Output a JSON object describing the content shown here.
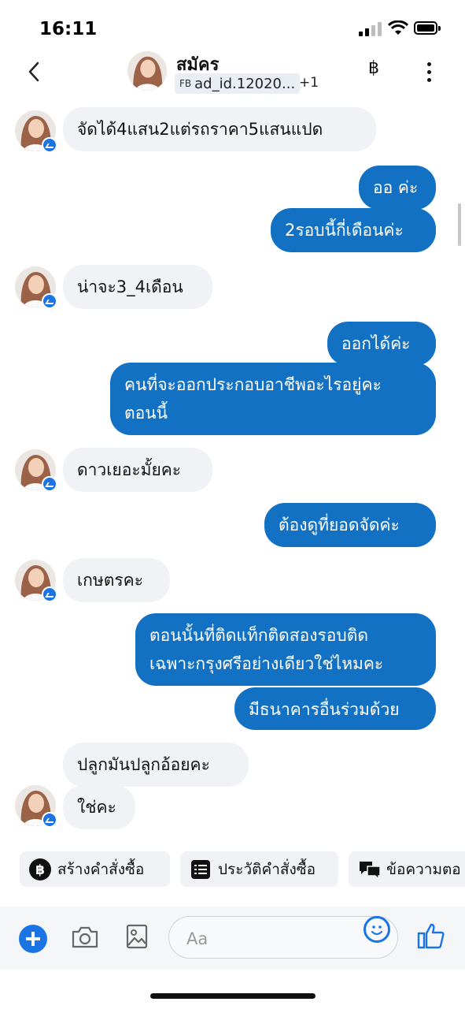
{
  "status_bar": {
    "time": "16:11"
  },
  "header": {
    "name": "สมัคร",
    "tag_prefix": "FB",
    "tag": "ad_id.12020...",
    "extra": "+1",
    "currency_symbol": "฿"
  },
  "messages": [
    {
      "dir": "in",
      "text": "จัดได้4แสน2แต่รถราคา5แสนแปด"
    },
    {
      "dir": "out",
      "text": "ออ ค่ะ"
    },
    {
      "dir": "out",
      "text": "2รอบนี้กี่เดือนค่ะ"
    },
    {
      "dir": "in",
      "text": "น่าจะ3_4เดือน"
    },
    {
      "dir": "out",
      "text": "ออกได้ค่ะ"
    },
    {
      "dir": "out",
      "text_line1": "คนที่จะออกประกอบอาชีพอะไรอยู่คะ",
      "text_line2": "ตอนนี้"
    },
    {
      "dir": "in",
      "text": "ดาวเยอะมั้ยคะ"
    },
    {
      "dir": "out",
      "text": "ต้องดูที่ยอดจัดค่ะ"
    },
    {
      "dir": "in",
      "text": "เกษตรคะ"
    },
    {
      "dir": "out",
      "text_line1": "ตอนนั้นที่ติดแท็กติดสองรอบติด",
      "text_line2": "เฉพาะกรุงศรีอย่างเดียวใช่ไหมคะ"
    },
    {
      "dir": "out",
      "text": "มีธนาคารอื่นร่วมด้วย"
    },
    {
      "dir": "in",
      "text": "ปลูกมันปลูกอ้อยคะ"
    },
    {
      "dir": "in",
      "text": "ใช่คะ"
    }
  ],
  "quick_actions": [
    {
      "label": "สร้างคำสั่งซื้อ",
      "icon": "baht-circle-icon"
    },
    {
      "label": "ประวัติคำสั่งซื้อ",
      "icon": "order-list-icon"
    },
    {
      "label": "ข้อความตอ",
      "icon": "chat-bubbles-icon"
    }
  ],
  "composer": {
    "placeholder": "Aa"
  },
  "colors": {
    "accent": "#1b74e4",
    "outgoing": "#1371c4",
    "incoming": "#f1f2f6"
  }
}
